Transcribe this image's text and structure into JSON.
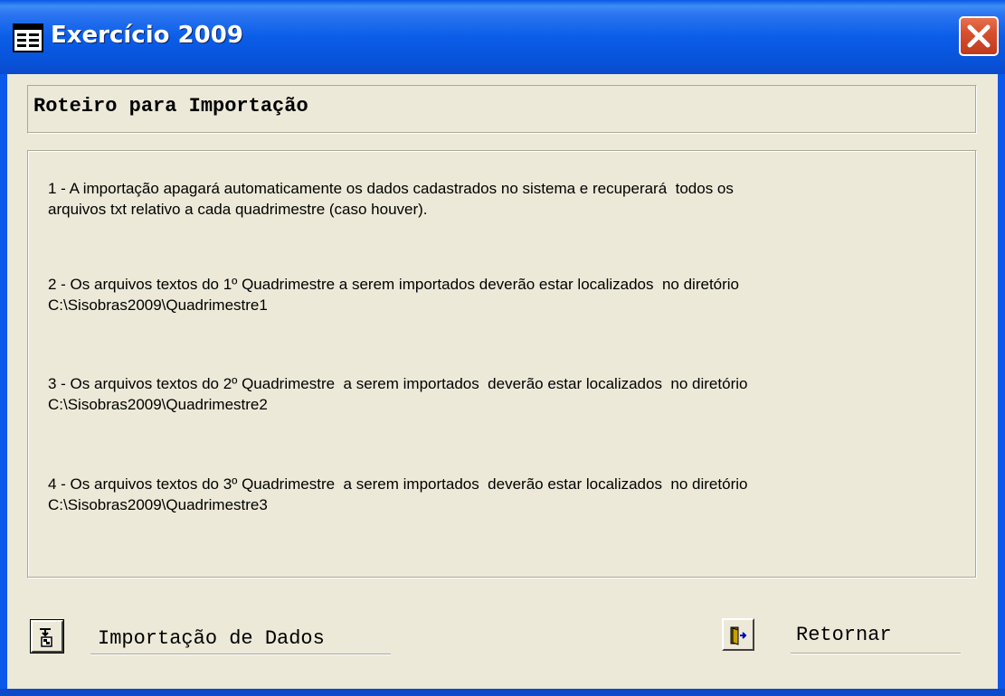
{
  "window": {
    "title": "Exercício 2009",
    "icon": "form-icon",
    "close_icon": "close-icon"
  },
  "heading": "Roteiro para Importação",
  "steps": [
    {
      "line1": "1 - A importação apagará automaticamente os dados cadastrados no sistema e recuperará  todos os",
      "line2": "arquivos txt relativo a cada quadrimestre (caso houver)."
    },
    {
      "line1": "2 - Os arquivos textos do 1º Quadrimestre a serem importados deverão estar localizados  no diretório",
      "line2": "C:\\Sisobras2009\\Quadrimestre1"
    },
    {
      "line1": "3 - Os arquivos textos do 2º Quadrimestre  a serem importados  deverão estar localizados  no diretório",
      "line2": "C:\\Sisobras2009\\Quadrimestre2"
    },
    {
      "line1": "4 - Os arquivos textos do 3º Quadrimestre  a serem importados  deverão estar localizados  no diretório",
      "line2": "C:\\Sisobras2009\\Quadrimestre3"
    }
  ],
  "actions": {
    "import_label": "Importação de Dados",
    "import_icon": "import-data-icon",
    "return_label": "Retornar",
    "return_icon": "exit-door-icon"
  }
}
